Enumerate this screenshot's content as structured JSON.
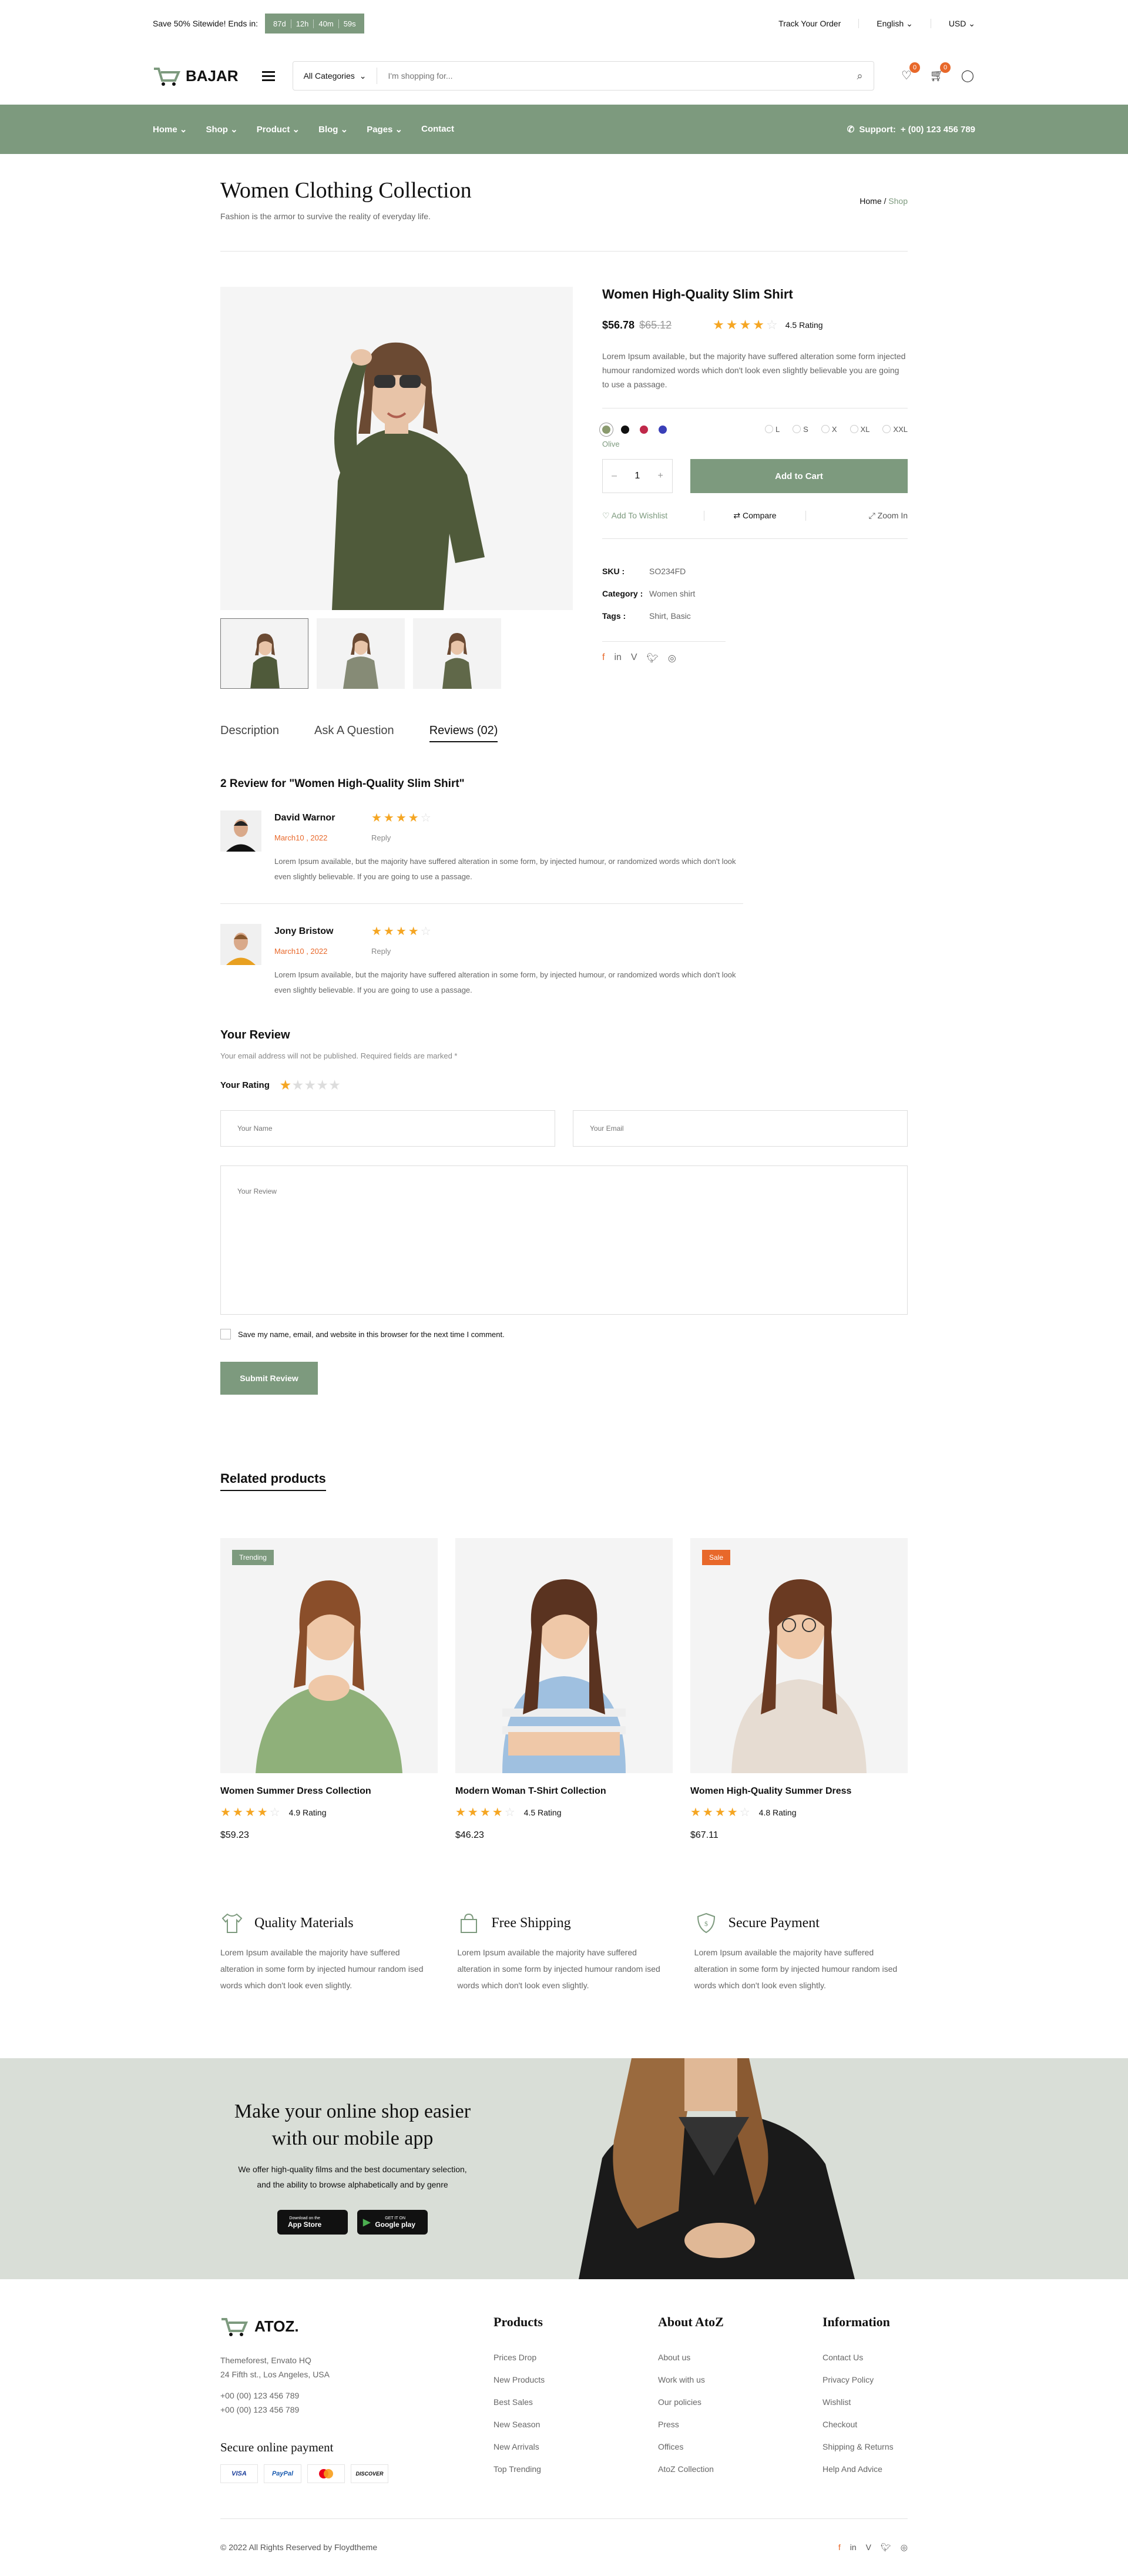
{
  "topbar": {
    "promo": "Save 50% Sitewide! Ends in:",
    "countdown": [
      "87d",
      "12h",
      "40m",
      "59s"
    ],
    "track": "Track Your Order",
    "language": "English",
    "currency": "USD"
  },
  "header": {
    "brand": "BAJAR",
    "category": "All Categories",
    "search_placeholder": "I'm shopping for...",
    "wishlist_count": "0",
    "cart_count": "0"
  },
  "nav": {
    "items": [
      "Home",
      "Shop",
      "Product",
      "Blog",
      "Pages",
      "Contact"
    ],
    "support_label": "Support:",
    "support_phone": "+ (00) 123 456 789"
  },
  "pagehead": {
    "title": "Women Clothing Collection",
    "subtitle": "Fashion is the armor to survive the reality of everyday life.",
    "crumb_home": "Home",
    "crumb_sep": "/",
    "crumb_current": "Shop"
  },
  "product": {
    "title": "Women High-Quality Slim Shirt",
    "price": "$56.78",
    "old_price": "$65.12",
    "rating_stars": 4.5,
    "rating_text": "4.5 Rating",
    "description": "Lorem Ipsum available, but the majority have suffered alteration some form injected humour randomized words which don't look even slightly believable you are going to use a passage.",
    "colors": [
      "#8a9a6e",
      "#111111",
      "#c0284a",
      "#3a3fb8"
    ],
    "color_name": "Olive",
    "sizes": [
      "L",
      "S",
      "X",
      "XL",
      "XXL"
    ],
    "qty": "1",
    "add_to_cart": "Add to Cart",
    "wishlist": "Add To Wishlist",
    "compare": "Compare",
    "zoom": "Zoom In",
    "sku_label": "SKU :",
    "sku": "SO234FD",
    "category_label": "Category :",
    "category": "Women shirt",
    "tags_label": "Tags :",
    "tags": "Shirt, Basic"
  },
  "tabs": [
    "Description",
    "Ask A Question",
    "Reviews (02)"
  ],
  "reviews": {
    "heading": "2 Review for \"Women High-Quality Slim Shirt\"",
    "items": [
      {
        "name": "David Warnor",
        "date": "March10 , 2022",
        "reply": "Reply",
        "stars": 4,
        "text": "Lorem Ipsum available, but the majority have suffered alteration in some form, by injected humour, or randomized words which don't look even slightly believable. If you are going to use a passage."
      },
      {
        "name": "Jony Bristow",
        "date": "March10 , 2022",
        "reply": "Reply",
        "stars": 4,
        "text": "Lorem Ipsum available, but the majority have suffered alteration in some form, by injected humour, or randomized words which don't look even slightly believable. If you are going to use a passage."
      }
    ]
  },
  "form": {
    "title": "Your Review",
    "note": "Your email address will not be published. Required fields are marked *",
    "rating_label": "Your Rating",
    "name_ph": "Your Name",
    "email_ph": "Your Email",
    "review_ph": "Your Review",
    "save_label": "Save my name, email, and website in this browser for the next time I comment.",
    "submit": "Submit Review"
  },
  "related": {
    "title": "Related products",
    "items": [
      {
        "tag": "Trending",
        "tag_color": "#7d9a7e",
        "name": "Women Summer Dress Collection",
        "rating": "4.9 Rating",
        "price": "$59.23"
      },
      {
        "tag": "",
        "tag_color": "",
        "name": "Modern Woman T-Shirt Collection",
        "rating": "4.5 Rating",
        "price": "$46.23"
      },
      {
        "tag": "Sale",
        "tag_color": "#e8682a",
        "name": "Women High-Quality Summer Dress",
        "rating": "4.8 Rating",
        "price": "$67.11"
      }
    ]
  },
  "features": [
    {
      "title": "Quality Materials",
      "text": "Lorem Ipsum available the majority have suffered alteration in some form by injected humour random ised words which don't look even slightly."
    },
    {
      "title": "Free Shipping",
      "text": "Lorem Ipsum available the majority have suffered alteration in some form by injected humour random ised words which don't look even slightly."
    },
    {
      "title": "Secure Payment",
      "text": "Lorem Ipsum available the majority have suffered alteration in some form by injected humour random ised words which don't look even slightly."
    }
  ],
  "app": {
    "title_1": "Make your online shop easier",
    "title_2": "with our mobile app",
    "text_1": "We offer high-quality films and the best documentary selection,",
    "text_2": "and the ability to browse alphabetically and by genre",
    "appstore_small": "Download on the",
    "appstore": "App Store",
    "gplay_small": "GET IT ON",
    "gplay": "Google play"
  },
  "footer": {
    "brand": "ATOZ.",
    "addr_1": "Themeforest, Envato HQ",
    "addr_2": "24 Fifth st., Los Angeles, USA",
    "phone_1": "+00 (00) 123 456 789",
    "phone_2": "+00 (00) 123 456 789",
    "pay_title": "Secure online payment",
    "pay": [
      "VISA",
      "PayPal",
      "MC",
      "DISCOVER"
    ],
    "col1_title": "Products",
    "col1": [
      "Prices Drop",
      "New Products",
      "Best Sales",
      "New Season",
      "New Arrivals",
      "Top Trending"
    ],
    "col2_title": "About AtoZ",
    "col2": [
      "About us",
      "Work with us",
      "Our policies",
      "Press",
      "Offices",
      "AtoZ Collection"
    ],
    "col3_title": "Information",
    "col3": [
      "Contact Us",
      "Privacy Policy",
      "Wishlist",
      "Checkout",
      "Shipping & Returns",
      "Help And Advice"
    ],
    "copyright": "© 2022 All Rights Reserved by Floydtheme"
  }
}
